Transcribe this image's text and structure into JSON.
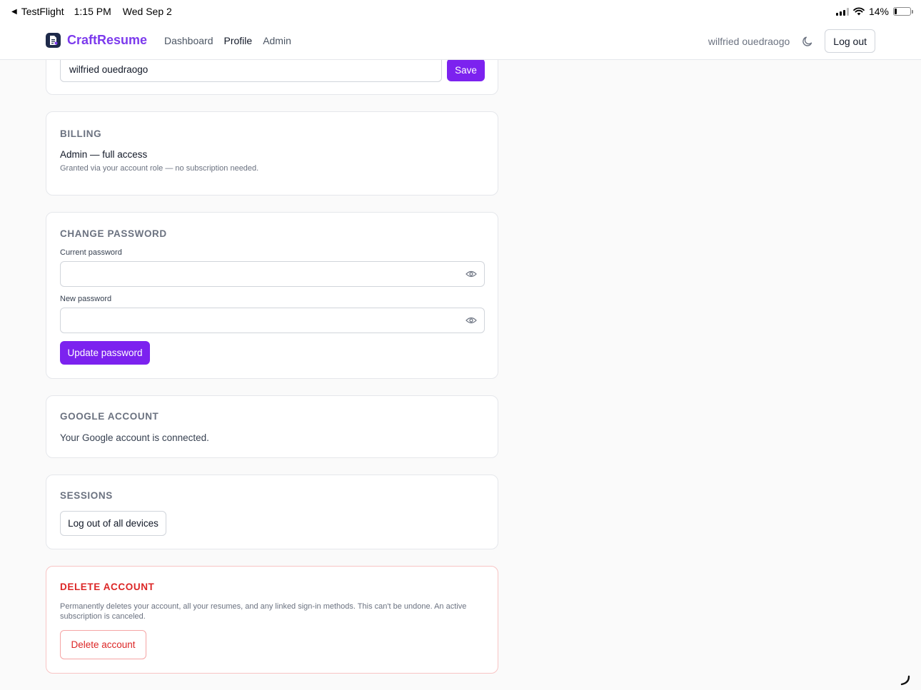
{
  "status_bar": {
    "back_app": "TestFlight",
    "time": "1:15 PM",
    "date": "Wed Sep 2",
    "battery_text": "14%",
    "battery_level": 0.14
  },
  "nav": {
    "brand": "CraftResume",
    "links": [
      "Dashboard",
      "Profile",
      "Admin"
    ],
    "active_link": "Profile",
    "user_name": "wilfried ouedraogo",
    "logout_label": "Log out"
  },
  "profile": {
    "name_value": "wilfried ouedraogo",
    "save_label": "Save"
  },
  "billing": {
    "title": "BILLING",
    "plan": "Admin — full access",
    "note": "Granted via your account role — no subscription needed."
  },
  "change_password": {
    "title": "CHANGE PASSWORD",
    "current_label": "Current password",
    "current_value": "",
    "new_label": "New password",
    "new_value": "",
    "submit_label": "Update password"
  },
  "google": {
    "title": "GOOGLE ACCOUNT",
    "status": "Your Google account is connected."
  },
  "sessions": {
    "title": "SESSIONS",
    "logout_all_label": "Log out of all devices"
  },
  "delete": {
    "title": "DELETE ACCOUNT",
    "description": "Permanently deletes your account, all your resumes, and any linked sign-in methods. This can't be undone. An active subscription is canceled.",
    "button_label": "Delete account"
  },
  "colors": {
    "accent": "#7c22ef",
    "brand": "#7c3aed",
    "danger": "#dc2626"
  }
}
